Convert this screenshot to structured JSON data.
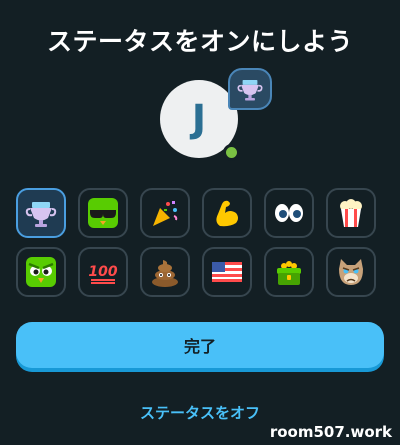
{
  "header": {
    "title": "ステータスをオンにしよう"
  },
  "avatar": {
    "initial": "J",
    "status_icon": "trophy-icon"
  },
  "status_options": [
    {
      "name": "trophy",
      "selected": true
    },
    {
      "name": "cool-duo",
      "selected": false
    },
    {
      "name": "party-popper",
      "selected": false
    },
    {
      "name": "flexed-biceps",
      "selected": false
    },
    {
      "name": "eyes",
      "selected": false
    },
    {
      "name": "popcorn",
      "selected": false
    },
    {
      "name": "angry-duo",
      "selected": false
    },
    {
      "name": "hundred-points",
      "selected": false
    },
    {
      "name": "pile-of-poo",
      "selected": false
    },
    {
      "name": "us-flag",
      "selected": false
    },
    {
      "name": "treasure-chest",
      "selected": false
    },
    {
      "name": "grumpy-cat",
      "selected": false
    }
  ],
  "actions": {
    "done_label": "完了",
    "turn_off_label": "ステータスをオフ"
  },
  "watermark": {
    "text": "room507.work"
  },
  "colors": {
    "background": "#131f24",
    "accent": "#49c0f8",
    "accent_shadow": "#1899d6",
    "selected_border": "#4a9ee0",
    "tile_border": "#37464f"
  }
}
